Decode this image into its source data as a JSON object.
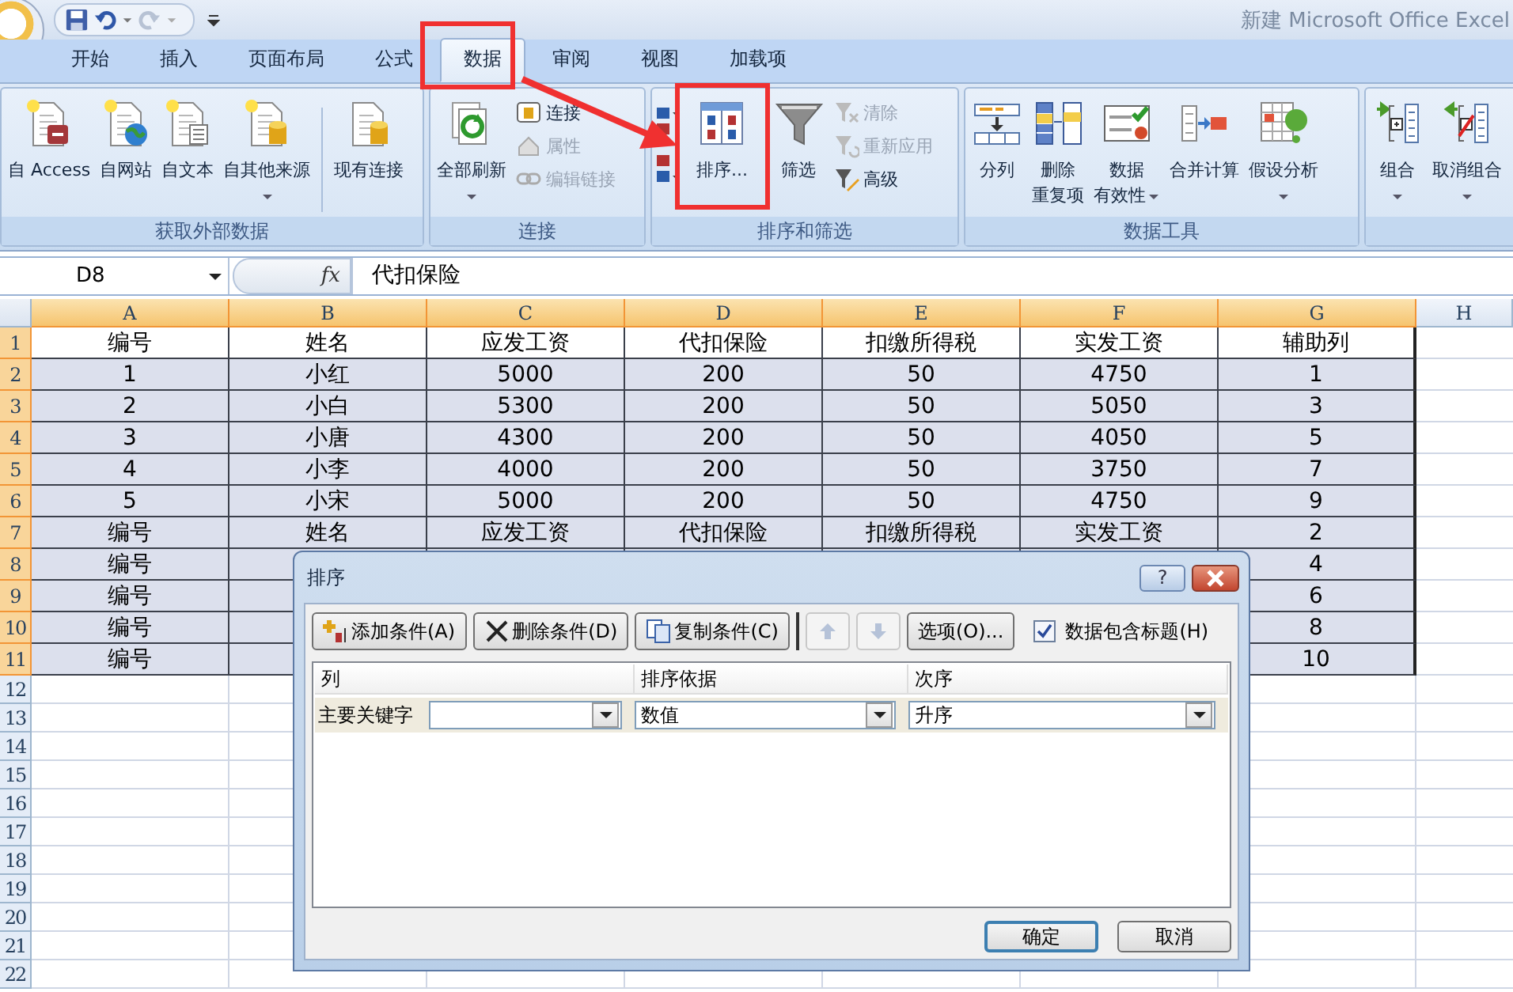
{
  "title_bar": {
    "title": "新建 Microsoft Office Excel"
  },
  "tabs": [
    {
      "label": "开始",
      "selected": false
    },
    {
      "label": "插入",
      "selected": false
    },
    {
      "label": "页面布局",
      "selected": false
    },
    {
      "label": "公式",
      "selected": false
    },
    {
      "label": "数据",
      "selected": true
    },
    {
      "label": "审阅",
      "selected": false
    },
    {
      "label": "视图",
      "selected": false
    },
    {
      "label": "加载项",
      "selected": false
    }
  ],
  "ribbon": {
    "groups": [
      {
        "label": "获取外部数据",
        "items": [
          {
            "kind": "large",
            "lines": [
              "自 Access"
            ]
          },
          {
            "kind": "large",
            "lines": [
              "自网站"
            ]
          },
          {
            "kind": "large",
            "lines": [
              "自文本"
            ]
          },
          {
            "kind": "large",
            "lines": [
              "自其他来源"
            ],
            "dropdown": true
          },
          {
            "kind": "separator"
          },
          {
            "kind": "large",
            "lines": [
              "现有连接"
            ]
          }
        ]
      },
      {
        "label": "连接",
        "items": [
          {
            "kind": "large",
            "lines": [
              "全部刷新"
            ],
            "dropdown": true
          },
          {
            "kind": "stack",
            "items": [
              {
                "label": "连接",
                "disabled": false
              },
              {
                "label": "属性",
                "disabled": true
              },
              {
                "label": "编辑链接",
                "disabled": true
              }
            ]
          }
        ]
      },
      {
        "label": "排序和筛选",
        "items": [
          {
            "kind": "sort-pair"
          },
          {
            "kind": "large",
            "lines": [
              "排序..."
            ]
          },
          {
            "kind": "large",
            "lines": [
              "筛选"
            ]
          },
          {
            "kind": "stack",
            "items": [
              {
                "label": "清除",
                "disabled": true
              },
              {
                "label": "重新应用",
                "disabled": true
              },
              {
                "label": "高级",
                "disabled": false
              }
            ]
          }
        ]
      },
      {
        "label": "数据工具",
        "items": [
          {
            "kind": "large",
            "lines": [
              "分列"
            ]
          },
          {
            "kind": "large",
            "lines": [
              "删除",
              "重复项"
            ]
          },
          {
            "kind": "large",
            "lines": [
              "数据",
              "有效性"
            ],
            "dropdown": true
          },
          {
            "kind": "large",
            "lines": [
              "合并计算"
            ]
          },
          {
            "kind": "large",
            "lines": [
              "假设分析"
            ],
            "dropdown": true
          }
        ]
      },
      {
        "items": [
          {
            "kind": "large",
            "lines": [
              "组合"
            ],
            "dropdown": true
          },
          {
            "kind": "large",
            "lines": [
              "取消组合"
            ],
            "dropdown": true
          }
        ]
      }
    ]
  },
  "formula_bar": {
    "name_box": "D8",
    "function_label": "fx",
    "content": "代扣保险"
  },
  "sheet": {
    "columns": [
      {
        "label": "A",
        "selected": true
      },
      {
        "label": "B",
        "selected": true
      },
      {
        "label": "C",
        "selected": true
      },
      {
        "label": "D",
        "selected": true
      },
      {
        "label": "E",
        "selected": true
      },
      {
        "label": "F",
        "selected": true
      },
      {
        "label": "G",
        "selected": true
      },
      {
        "label": "H",
        "selected": false
      }
    ],
    "rows": [
      {
        "num": "1",
        "selected": true,
        "shaded": false,
        "cells": [
          "编号",
          "姓名",
          "应发工资",
          "代扣保险",
          "扣缴所得税",
          "实发工资"
        ],
        "col_g": "辅助列"
      },
      {
        "num": "2",
        "selected": true,
        "shaded": true,
        "cells": [
          "1",
          "小红",
          "5000",
          "200",
          "50",
          "4750"
        ],
        "col_g": "1"
      },
      {
        "num": "3",
        "selected": true,
        "shaded": true,
        "cells": [
          "2",
          "小白",
          "5300",
          "200",
          "50",
          "5050"
        ],
        "col_g": "3"
      },
      {
        "num": "4",
        "selected": true,
        "shaded": true,
        "cells": [
          "3",
          "小唐",
          "4300",
          "200",
          "50",
          "4050"
        ],
        "col_g": "5"
      },
      {
        "num": "5",
        "selected": true,
        "shaded": true,
        "cells": [
          "4",
          "小李",
          "4000",
          "200",
          "50",
          "3750"
        ],
        "col_g": "7"
      },
      {
        "num": "6",
        "selected": true,
        "shaded": true,
        "cells": [
          "5",
          "小宋",
          "5000",
          "200",
          "50",
          "4750"
        ],
        "col_g": "9"
      },
      {
        "num": "7",
        "selected": true,
        "shaded": true,
        "cells": [
          "编号",
          "姓名",
          "应发工资",
          "代扣保险",
          "扣缴所得税",
          "实发工资"
        ],
        "col_g": "2"
      },
      {
        "num": "8",
        "selected": true,
        "shaded": true,
        "cells": [
          "编号"
        ],
        "col_g": "4"
      },
      {
        "num": "9",
        "selected": true,
        "shaded": true,
        "cells": [
          "编号"
        ],
        "col_g": "6"
      },
      {
        "num": "10",
        "selected": true,
        "shaded": true,
        "cells": [
          "编号"
        ],
        "col_g": "8"
      },
      {
        "num": "11",
        "selected": true,
        "shaded": true,
        "cells": [
          "编号"
        ],
        "col_g": "10"
      },
      {
        "num": "12",
        "selected": false,
        "shaded": false
      },
      {
        "num": "13",
        "selected": false,
        "shaded": false
      },
      {
        "num": "14",
        "selected": false,
        "shaded": false
      },
      {
        "num": "15",
        "selected": false,
        "shaded": false
      },
      {
        "num": "16",
        "selected": false,
        "shaded": false
      },
      {
        "num": "17",
        "selected": false,
        "shaded": false
      },
      {
        "num": "18",
        "selected": false,
        "shaded": false
      },
      {
        "num": "19",
        "selected": false,
        "shaded": false
      },
      {
        "num": "20",
        "selected": false,
        "shaded": false
      },
      {
        "num": "21",
        "selected": false,
        "shaded": false
      },
      {
        "num": "22",
        "selected": false,
        "shaded": false
      }
    ]
  },
  "dialog": {
    "title": "排序",
    "help": "?",
    "toolbar": [
      {
        "kind": "button",
        "label": "添加条件(A)"
      },
      {
        "kind": "button",
        "label": "删除条件(D)"
      },
      {
        "kind": "button",
        "label": "复制条件(C)"
      },
      {
        "kind": "move-up",
        "disabled": true
      },
      {
        "kind": "move-down",
        "disabled": true
      },
      {
        "kind": "button",
        "label": "选项(O)..."
      }
    ],
    "header_checkbox": {
      "label": "数据包含标题(H)",
      "checked": true
    },
    "columns": [
      "列",
      "排序依据",
      "次序"
    ],
    "levels": [
      {
        "label": "主要关键字",
        "sort_on": "数值",
        "order": "升序"
      }
    ],
    "buttons": [
      {
        "label": "确定",
        "default": true
      },
      {
        "label": "取消",
        "default": false
      }
    ]
  }
}
